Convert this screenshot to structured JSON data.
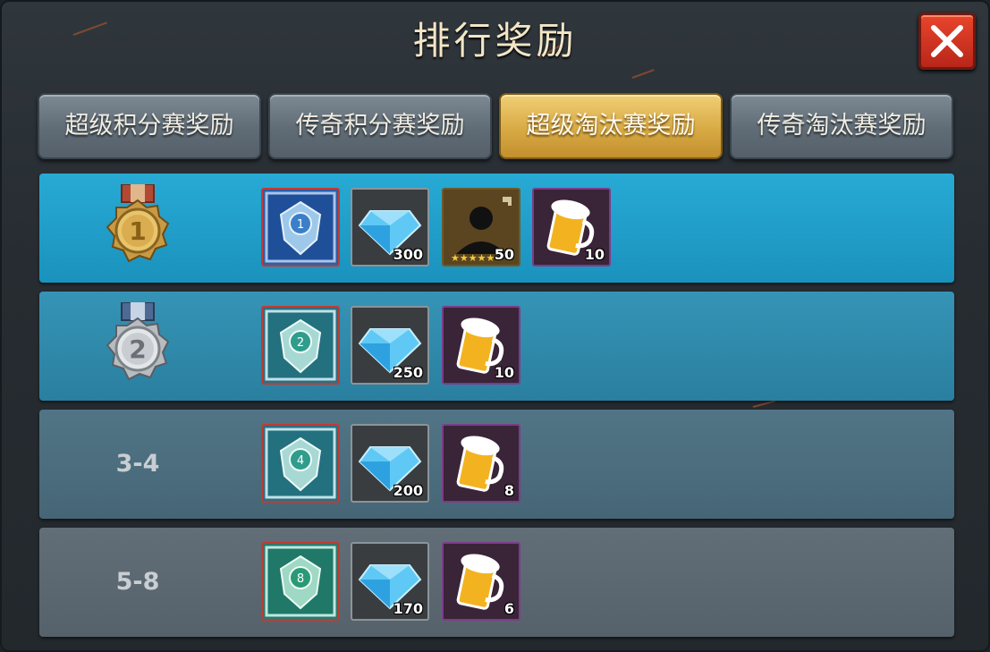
{
  "window": {
    "title": "排行奖励"
  },
  "tabs": [
    {
      "label": "超级积分赛奖励",
      "active": false
    },
    {
      "label": "传奇积分赛奖励",
      "active": false
    },
    {
      "label": "超级淘汰赛奖励",
      "active": true
    },
    {
      "label": "传奇淘汰赛奖励",
      "active": false
    }
  ],
  "rows": [
    {
      "rank_label": "1",
      "rank_display": "gold-medal",
      "rewards": [
        {
          "icon": "badge-icon",
          "badge_number": "1",
          "count": ""
        },
        {
          "icon": "diamond-icon",
          "count": "300"
        },
        {
          "icon": "player-card-icon",
          "count": "50",
          "stars": 5
        },
        {
          "icon": "beer-icon",
          "count": "10"
        }
      ]
    },
    {
      "rank_label": "2",
      "rank_display": "silver-medal",
      "rewards": [
        {
          "icon": "badge-icon",
          "badge_number": "2",
          "count": ""
        },
        {
          "icon": "diamond-icon",
          "count": "250"
        },
        {
          "icon": "beer-icon",
          "count": "10"
        }
      ]
    },
    {
      "rank_label": "3-4",
      "rank_display": "text",
      "rewards": [
        {
          "icon": "badge-icon",
          "badge_number": "4",
          "count": ""
        },
        {
          "icon": "diamond-icon",
          "count": "200"
        },
        {
          "icon": "beer-icon",
          "count": "8"
        }
      ]
    },
    {
      "rank_label": "5-8",
      "rank_display": "text",
      "rewards": [
        {
          "icon": "badge-icon",
          "badge_number": "8",
          "count": ""
        },
        {
          "icon": "diamond-icon",
          "count": "170"
        },
        {
          "icon": "beer-icon",
          "count": "6"
        }
      ]
    }
  ],
  "colors": {
    "row1": "#1e9cc6",
    "row2": "#2b84a3",
    "row3": "#4a6b7d",
    "row4": "#5b6770",
    "active_tab": "#d8aa44",
    "close_button": "#d63a24"
  }
}
